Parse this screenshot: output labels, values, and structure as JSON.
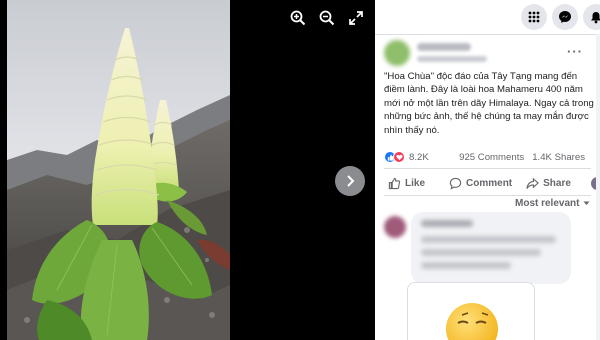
{
  "viewer": {
    "tools": [
      "zoom-in-icon",
      "zoom-out-icon",
      "fullscreen-icon"
    ],
    "next_icon": "chevron-right-icon"
  },
  "topbar": {
    "icons": [
      "apps-grid-icon",
      "messenger-icon",
      "notifications-bell-icon"
    ]
  },
  "post": {
    "more_label": "···",
    "text": "\"Hoa Chùa\" độc đáo của Tây Tạng mang đến điềm lành. Đây là loài hoa Mahameru 400 năm mới nở một lần trên dãy Himalaya. Ngay cả trong những bức ảnh, thế hệ chúng ta may mắn được nhìn thấy nó.",
    "reaction_count": "8.2K",
    "comments_count": "925 Comments",
    "shares_count": "1.4K Shares",
    "colors": {
      "like": "#1877f2",
      "love": "#f33e58",
      "text": "#1c1e21",
      "muted": "#65676b"
    }
  },
  "actions": {
    "like": "Like",
    "comment": "Comment",
    "share": "Share"
  },
  "comments": {
    "sort_label": "Most relevant"
  }
}
